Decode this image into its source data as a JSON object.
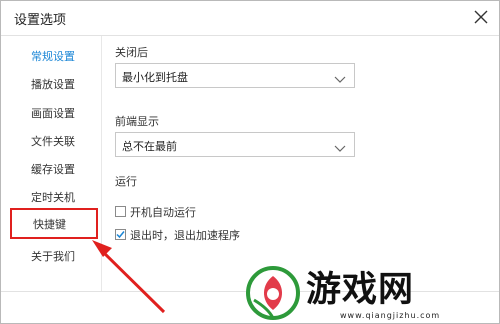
{
  "dialog": {
    "title": "设置选项"
  },
  "sidebar": {
    "items": [
      {
        "label": "常规设置",
        "active": true
      },
      {
        "label": "播放设置",
        "active": false
      },
      {
        "label": "画面设置",
        "active": false
      },
      {
        "label": "文件关联",
        "active": false
      },
      {
        "label": "缓存设置",
        "active": false
      },
      {
        "label": "定时关机",
        "active": false
      },
      {
        "label": "快捷键",
        "active": false
      },
      {
        "label": "关于我们",
        "active": false
      }
    ]
  },
  "content": {
    "close_label": "关闭后",
    "close_value": "最小化到托盘",
    "front_label": "前端显示",
    "front_value": "总不在最前",
    "run_label": "运行",
    "run_options": [
      {
        "label": "开机自动运行",
        "checked": false
      },
      {
        "label": "退出时，退出加速程序",
        "checked": true
      }
    ]
  },
  "watermark": {
    "text": "游戏网",
    "url": "www.qiangjizhu.com"
  },
  "colors": {
    "accent": "#1b86d6",
    "highlight": "#e0201e"
  }
}
